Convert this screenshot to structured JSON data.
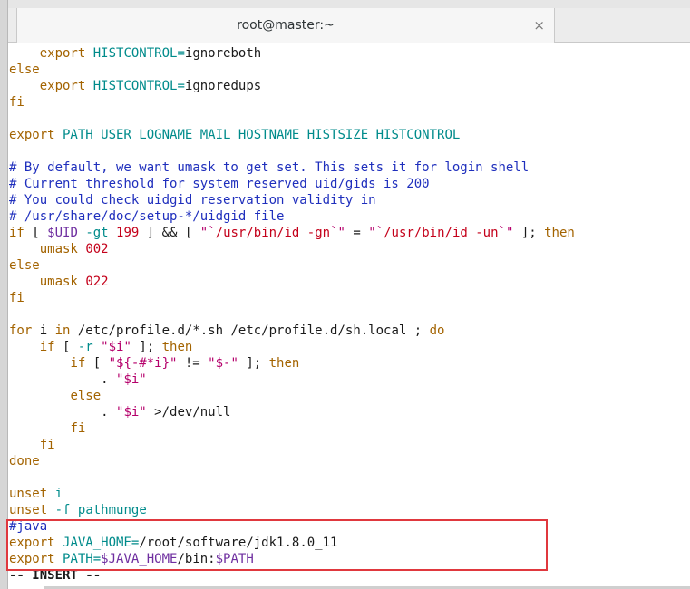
{
  "window": {
    "title": "root@master:~",
    "close_symbol": "×"
  },
  "lines": [
    [
      {
        "t": "    ",
        "c": "plain"
      },
      {
        "t": "export",
        "c": "kw"
      },
      {
        "t": " ",
        "c": "plain"
      },
      {
        "t": "HISTCONTROL=",
        "c": "var"
      },
      {
        "t": "ignoreboth",
        "c": "plain"
      }
    ],
    [
      {
        "t": "else",
        "c": "kw"
      }
    ],
    [
      {
        "t": "    ",
        "c": "plain"
      },
      {
        "t": "export",
        "c": "kw"
      },
      {
        "t": " ",
        "c": "plain"
      },
      {
        "t": "HISTCONTROL=",
        "c": "var"
      },
      {
        "t": "ignoredups",
        "c": "plain"
      }
    ],
    [
      {
        "t": "fi",
        "c": "kw"
      }
    ],
    [
      {
        "t": "",
        "c": "plain"
      }
    ],
    [
      {
        "t": "export",
        "c": "kw"
      },
      {
        "t": " PATH USER LOGNAME MAIL HOSTNAME HISTSIZE HISTCONTROL",
        "c": "var"
      }
    ],
    [
      {
        "t": "",
        "c": "plain"
      }
    ],
    [
      {
        "t": "# By default, we want umask to get set. This sets it for login shell",
        "c": "cmt"
      }
    ],
    [
      {
        "t": "# Current threshold for system reserved uid/gids is 200",
        "c": "cmt"
      }
    ],
    [
      {
        "t": "# You could check uidgid reservation validity in",
        "c": "cmt"
      }
    ],
    [
      {
        "t": "# /usr/share/doc/setup-*/uidgid file",
        "c": "cmt"
      }
    ],
    [
      {
        "t": "if",
        "c": "kw"
      },
      {
        "t": " [ ",
        "c": "plain"
      },
      {
        "t": "$UID",
        "c": "op"
      },
      {
        "t": " ",
        "c": "plain"
      },
      {
        "t": "-gt",
        "c": "var"
      },
      {
        "t": " ",
        "c": "plain"
      },
      {
        "t": "199",
        "c": "num"
      },
      {
        "t": " ] && [ ",
        "c": "plain"
      },
      {
        "t": "\"`",
        "c": "str"
      },
      {
        "t": "/usr/bin/id -gn",
        "c": "num"
      },
      {
        "t": "`\"",
        "c": "str"
      },
      {
        "t": " = ",
        "c": "plain"
      },
      {
        "t": "\"`",
        "c": "str"
      },
      {
        "t": "/usr/bin/id -un",
        "c": "num"
      },
      {
        "t": "`\"",
        "c": "str"
      },
      {
        "t": " ]; ",
        "c": "plain"
      },
      {
        "t": "then",
        "c": "kw"
      }
    ],
    [
      {
        "t": "    ",
        "c": "plain"
      },
      {
        "t": "umask",
        "c": "kw"
      },
      {
        "t": " ",
        "c": "plain"
      },
      {
        "t": "002",
        "c": "num"
      }
    ],
    [
      {
        "t": "else",
        "c": "kw"
      }
    ],
    [
      {
        "t": "    ",
        "c": "plain"
      },
      {
        "t": "umask",
        "c": "kw"
      },
      {
        "t": " ",
        "c": "plain"
      },
      {
        "t": "022",
        "c": "num"
      }
    ],
    [
      {
        "t": "fi",
        "c": "kw"
      }
    ],
    [
      {
        "t": "",
        "c": "plain"
      }
    ],
    [
      {
        "t": "for",
        "c": "kw"
      },
      {
        "t": " i ",
        "c": "plain"
      },
      {
        "t": "in",
        "c": "kw"
      },
      {
        "t": " /etc/profile.d/*.sh /etc/profile.d/sh.local ; ",
        "c": "plain"
      },
      {
        "t": "do",
        "c": "kw"
      }
    ],
    [
      {
        "t": "    ",
        "c": "plain"
      },
      {
        "t": "if",
        "c": "kw"
      },
      {
        "t": " [ ",
        "c": "plain"
      },
      {
        "t": "-r",
        "c": "var"
      },
      {
        "t": " ",
        "c": "plain"
      },
      {
        "t": "\"$i\"",
        "c": "str"
      },
      {
        "t": " ]; ",
        "c": "plain"
      },
      {
        "t": "then",
        "c": "kw"
      }
    ],
    [
      {
        "t": "        ",
        "c": "plain"
      },
      {
        "t": "if",
        "c": "kw"
      },
      {
        "t": " [ ",
        "c": "plain"
      },
      {
        "t": "\"${-#*i}\"",
        "c": "str"
      },
      {
        "t": " != ",
        "c": "plain"
      },
      {
        "t": "\"$-\"",
        "c": "str"
      },
      {
        "t": " ]; ",
        "c": "plain"
      },
      {
        "t": "then",
        "c": "kw"
      }
    ],
    [
      {
        "t": "            . ",
        "c": "plain"
      },
      {
        "t": "\"$i\"",
        "c": "str"
      }
    ],
    [
      {
        "t": "        ",
        "c": "plain"
      },
      {
        "t": "else",
        "c": "kw"
      }
    ],
    [
      {
        "t": "            . ",
        "c": "plain"
      },
      {
        "t": "\"$i\"",
        "c": "str"
      },
      {
        "t": " >/dev/null",
        "c": "plain"
      }
    ],
    [
      {
        "t": "        ",
        "c": "plain"
      },
      {
        "t": "fi",
        "c": "kw"
      }
    ],
    [
      {
        "t": "    ",
        "c": "plain"
      },
      {
        "t": "fi",
        "c": "kw"
      }
    ],
    [
      {
        "t": "done",
        "c": "kw"
      }
    ],
    [
      {
        "t": "",
        "c": "plain"
      }
    ],
    [
      {
        "t": "unset",
        "c": "kw"
      },
      {
        "t": " ",
        "c": "plain"
      },
      {
        "t": "i",
        "c": "var"
      }
    ],
    [
      {
        "t": "unset",
        "c": "kw"
      },
      {
        "t": " ",
        "c": "plain"
      },
      {
        "t": "-f",
        "c": "var"
      },
      {
        "t": " ",
        "c": "plain"
      },
      {
        "t": "pathmunge",
        "c": "var"
      }
    ],
    [
      {
        "t": "#java",
        "c": "cmt"
      }
    ],
    [
      {
        "t": "export",
        "c": "kw"
      },
      {
        "t": " ",
        "c": "plain"
      },
      {
        "t": "JAVA_HOME=",
        "c": "var"
      },
      {
        "t": "/root/software/jdk1.8.0_11",
        "c": "plain"
      }
    ],
    [
      {
        "t": "export",
        "c": "kw"
      },
      {
        "t": " ",
        "c": "plain"
      },
      {
        "t": "PATH=",
        "c": "var"
      },
      {
        "t": "$JAVA_HOME",
        "c": "op"
      },
      {
        "t": "/bin:",
        "c": "plain"
      },
      {
        "t": "$PATH",
        "c": "op"
      }
    ],
    [
      {
        "t": "-- INSERT --",
        "c": "plain status"
      }
    ]
  ],
  "colors": {
    "highlight_box": "#e0383e",
    "keyword": "#a36300",
    "variable": "#008b8b",
    "comment": "#1f2fbd",
    "string": "#b5006b",
    "number": "#c4001a"
  }
}
